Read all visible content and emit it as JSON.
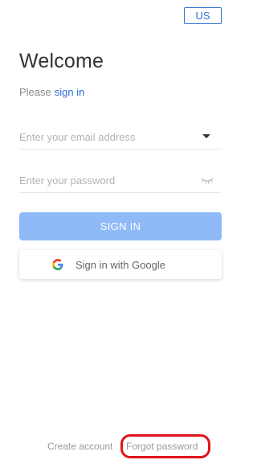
{
  "region": {
    "label": "US"
  },
  "header": {
    "title": "Welcome",
    "prompt_text": "Please",
    "prompt_link": "sign in"
  },
  "form": {
    "email_placeholder": "Enter your email address",
    "email_value": "",
    "password_placeholder": "Enter your password",
    "password_value": "",
    "sign_in_label": "SIGN IN",
    "google_label": "Sign in with Google"
  },
  "footer": {
    "create_account": "Create account",
    "forgot_password": "Forgot password"
  },
  "colors": {
    "accent": "#2d6fd6",
    "button_disabled": "#8fb9f7",
    "highlight": "#e0141b"
  },
  "icons": {
    "dropdown": "chevron-down-icon",
    "password": "eye-closed-icon",
    "google": "google-logo-icon"
  }
}
